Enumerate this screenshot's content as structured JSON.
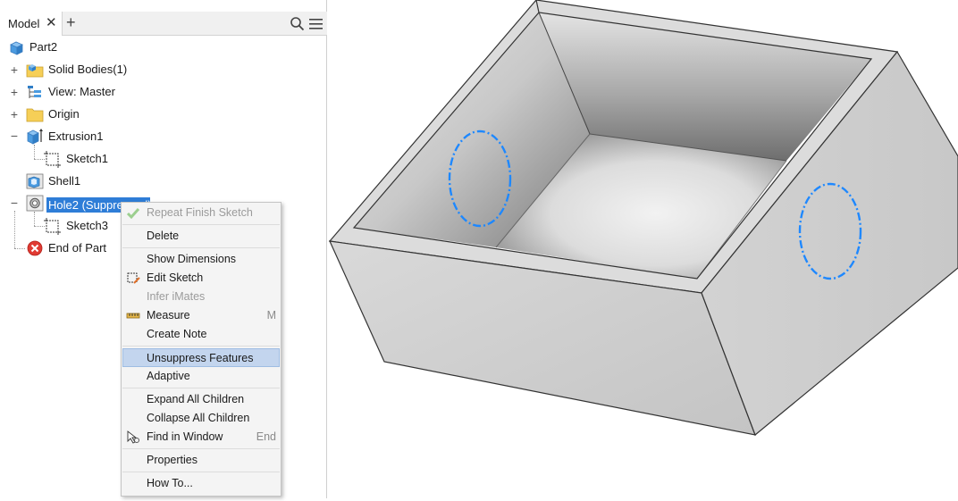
{
  "browser": {
    "tab_label": "Model",
    "close_glyph": "✕",
    "add_glyph": "+"
  },
  "tree": {
    "root": "Part2",
    "solid_bodies": "Solid Bodies(1)",
    "view": "View: Master",
    "origin": "Origin",
    "extrusion": "Extrusion1",
    "sketch1": "Sketch1",
    "shell": "Shell1",
    "hole": "Hole2 (Suppressed)",
    "sketch3": "Sketch3",
    "end_of_part": "End of Part"
  },
  "context_menu": {
    "repeat": "Repeat Finish Sketch",
    "delete": "Delete",
    "show_dimensions": "Show Dimensions",
    "edit_sketch": "Edit Sketch",
    "infer_imates": "Infer iMates",
    "measure": "Measure",
    "measure_key": "M",
    "create_note": "Create Note",
    "unsuppress": "Unsuppress Features",
    "adaptive": "Adaptive",
    "expand_all": "Expand All Children",
    "collapse_all": "Collapse All Children",
    "find_in_window": "Find in Window",
    "find_key": "End",
    "properties": "Properties",
    "how_to": "How To..."
  },
  "colors": {
    "selection": "#2e7dd7",
    "menu_highlight": "#c3d5ee",
    "hole_outline": "#1e88ff"
  }
}
